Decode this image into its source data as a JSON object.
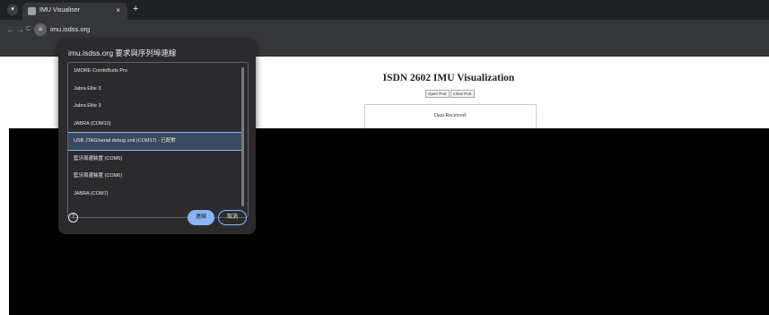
{
  "browser": {
    "tab_title": "IMU Visualiser",
    "tab_close": "×",
    "new_tab": "+",
    "back": "←",
    "forward": "→",
    "reload": "C",
    "url": "imu.isdss.org"
  },
  "page": {
    "title": "ISDN 2602 IMU Visualization",
    "open_port": "Open Port",
    "close_port": "Close Port",
    "data_label": "Data Received:"
  },
  "dialog": {
    "title": "imu.isdss.org 要求與序列埠連線",
    "items": [
      {
        "label": "1MORE ComfoBuds Pro"
      },
      {
        "label": "Jabra Elite 3"
      },
      {
        "label": "Jabra Elite 3"
      },
      {
        "label": "JABRA (COM10)"
      },
      {
        "label": "USB JTAG/serial debug unit (COM17) - 已配對"
      },
      {
        "label": "藍牙周邊裝置 (COM5)"
      },
      {
        "label": "藍牙周邊裝置 (COM6)"
      },
      {
        "label": "JABRA (COM7)"
      }
    ],
    "selected_index": 4,
    "help": "?",
    "connect_label": "連線",
    "cancel_label": "取消"
  },
  "colors": {
    "accent": "#8ab4f8",
    "dialog_bg": "#2b2b2d",
    "selected_bg": "#3a4a5e"
  }
}
